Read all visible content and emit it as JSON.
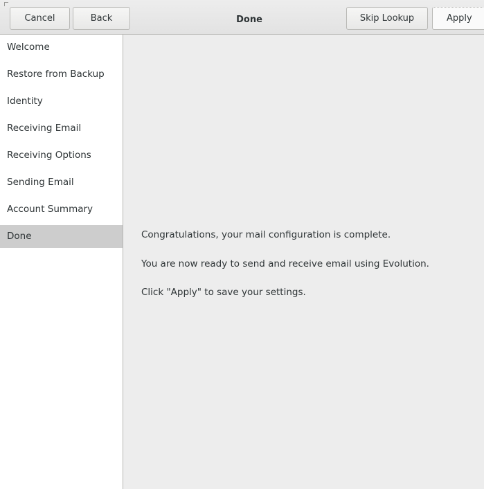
{
  "header": {
    "title": "Done",
    "cancel_label": "Cancel",
    "back_label": "Back",
    "skip_lookup_label": "Skip Lookup",
    "apply_label": "Apply"
  },
  "sidebar": {
    "items": [
      {
        "label": "Welcome",
        "selected": false
      },
      {
        "label": "Restore from Backup",
        "selected": false
      },
      {
        "label": "Identity",
        "selected": false
      },
      {
        "label": "Receiving Email",
        "selected": false
      },
      {
        "label": "Receiving Options",
        "selected": false
      },
      {
        "label": "Sending Email",
        "selected": false
      },
      {
        "label": "Account Summary",
        "selected": false
      },
      {
        "label": "Done",
        "selected": true
      }
    ]
  },
  "main": {
    "line1": "Congratulations, your mail configuration is complete.",
    "line2": "You are now ready to send and receive email using Evolution.",
    "line3": "Click \"Apply\" to save your settings."
  },
  "colors": {
    "selected_bg": "#cdcdcd",
    "content_bg": "#ededed",
    "sidebar_bg": "#ffffff"
  }
}
